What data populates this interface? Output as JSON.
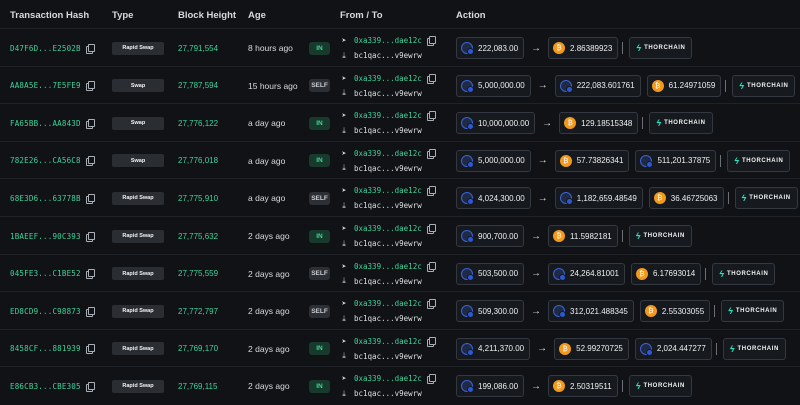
{
  "headers": {
    "hash": "Transaction Hash",
    "type": "Type",
    "height": "Block Height",
    "age": "Age",
    "fromto": "From / To",
    "action": "Action"
  },
  "from_address": "0xa339...dae12c",
  "to_address": "bc1qac...v9ewrw",
  "thorchain_label": "THORCHAIN",
  "icons": {
    "copy": "copy-icon",
    "send": "send-icon",
    "receive": "receive-icon",
    "arrow": "arrow-right-icon",
    "rune": "rune-coin-icon",
    "btc": "btc-coin-icon",
    "thorchain": "thorchain-logo-icon"
  },
  "colors": {
    "accent_green": "#3fd39a",
    "btc_orange": "#f39a1c",
    "rune_blue": "#2b58d8",
    "thorchain_teal": "#2fe0c0"
  },
  "rows": [
    {
      "hash": "D47F6D...E2502B",
      "type": "Rapid Swap",
      "height": "27,791,554",
      "age": "8 hours ago",
      "dir": "IN",
      "in": "222,083.00",
      "outs": [
        {
          "coin": "btc",
          "amount": "2.86389923"
        }
      ]
    },
    {
      "hash": "AA8A5E...7E5FE9",
      "type": "Swap",
      "height": "27,787,594",
      "age": "15 hours ago",
      "dir": "SELF",
      "in": "5,000,000.00",
      "outs": [
        {
          "coin": "rune",
          "amount": "222,083.601761"
        },
        {
          "coin": "btc",
          "amount": "61.24971059"
        }
      ]
    },
    {
      "hash": "FA65BB...AA843D",
      "type": "Swap",
      "height": "27,776,122",
      "age": "a day ago",
      "dir": "IN",
      "in": "10,000,000.00",
      "outs": [
        {
          "coin": "btc",
          "amount": "129.18515348"
        }
      ]
    },
    {
      "hash": "782E26...CA56C8",
      "type": "Swap",
      "height": "27,776,018",
      "age": "a day ago",
      "dir": "IN",
      "in": "5,000,000.00",
      "outs": [
        {
          "coin": "btc",
          "amount": "57.73826341"
        },
        {
          "coin": "rune",
          "amount": "511,201.37875"
        }
      ]
    },
    {
      "hash": "68E3D6...63778B",
      "type": "Rapid Swap",
      "height": "27,775,910",
      "age": "a day ago",
      "dir": "SELF",
      "in": "4,024,300.00",
      "outs": [
        {
          "coin": "rune",
          "amount": "1,182,659.48549"
        },
        {
          "coin": "btc",
          "amount": "36.46725063"
        }
      ]
    },
    {
      "hash": "1BAEEF...90C393",
      "type": "Rapid Swap",
      "height": "27,775,632",
      "age": "2 days ago",
      "dir": "IN",
      "in": "900,700.00",
      "outs": [
        {
          "coin": "btc",
          "amount": "11.5982181"
        }
      ]
    },
    {
      "hash": "045FE3...C1BE52",
      "type": "Rapid Swap",
      "height": "27,775,559",
      "age": "2 days ago",
      "dir": "SELF",
      "in": "503,500.00",
      "outs": [
        {
          "coin": "rune",
          "amount": "24,264.81001"
        },
        {
          "coin": "btc",
          "amount": "6.17693014"
        }
      ]
    },
    {
      "hash": "ED8CD9...C98873",
      "type": "Rapid Swap",
      "height": "27,772,797",
      "age": "2 days ago",
      "dir": "SELF",
      "in": "509,300.00",
      "outs": [
        {
          "coin": "rune",
          "amount": "312,021.488345"
        },
        {
          "coin": "btc",
          "amount": "2.55303055"
        }
      ]
    },
    {
      "hash": "8458CF...881939",
      "type": "Rapid Swap",
      "height": "27,769,170",
      "age": "2 days ago",
      "dir": "IN",
      "in": "4,211,370.00",
      "outs": [
        {
          "coin": "btc",
          "amount": "52.99270725"
        },
        {
          "coin": "rune",
          "amount": "2,024.447277"
        }
      ]
    },
    {
      "hash": "E86CB3...CBE305",
      "type": "Rapid Swap",
      "height": "27,769,115",
      "age": "2 days ago",
      "dir": "IN",
      "in": "199,086.00",
      "outs": [
        {
          "coin": "btc",
          "amount": "2.50319511"
        }
      ]
    }
  ]
}
